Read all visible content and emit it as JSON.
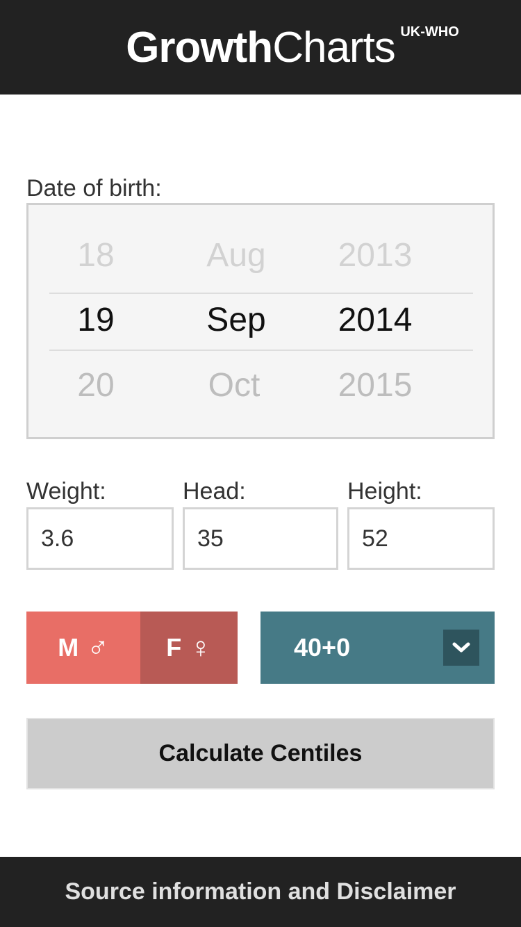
{
  "header": {
    "logo_bold": "Growth",
    "logo_light": "Charts",
    "logo_superscript": "UK-WHO"
  },
  "date_of_birth": {
    "label": "Date of birth:",
    "day": {
      "previous": "18",
      "selected": "19",
      "next": "20"
    },
    "month": {
      "previous": "Aug",
      "selected": "Sep",
      "next": "Oct"
    },
    "year": {
      "previous": "2013",
      "selected": "2014",
      "next": "2015"
    }
  },
  "measurements": {
    "weight": {
      "label": "Weight:",
      "value": "3.6"
    },
    "head": {
      "label": "Head:",
      "value": "35"
    },
    "height": {
      "label": "Height:",
      "value": "52"
    }
  },
  "gender": {
    "male_label": "M",
    "male_symbol": "♂",
    "female_label": "F",
    "female_symbol": "♀"
  },
  "gestation": {
    "selected": "40+0",
    "icon": "chevron-down-icon"
  },
  "calculate_button": "Calculate Centiles",
  "footer": {
    "link": "Source information and Disclaimer"
  },
  "colors": {
    "header_bg": "#222222",
    "male": "#e86e66",
    "female": "#b85a55",
    "gestation": "#467a86",
    "gestation_arrow": "#2e545d",
    "button": "#cccccc"
  }
}
